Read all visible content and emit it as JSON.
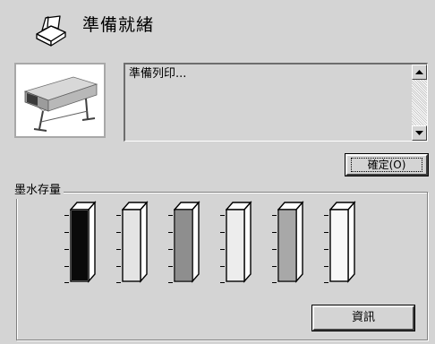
{
  "status": {
    "title": "準備就緒",
    "icon": "printer-status-icon"
  },
  "message": {
    "text": "準備列印..."
  },
  "buttons": {
    "ok_label": "確定(O)",
    "info_label": "資訊"
  },
  "ink": {
    "legend": "墨水存量",
    "cartridges": [
      {
        "color": "#0a0a0a",
        "level": 1.0
      },
      {
        "color": "#e4e4e4",
        "level": 1.0
      },
      {
        "color": "#8e8e8e",
        "level": 1.0
      },
      {
        "color": "#ededed",
        "level": 1.0
      },
      {
        "color": "#a8a8a8",
        "level": 1.0
      },
      {
        "color": "#f8f8f8",
        "level": 1.0
      }
    ]
  },
  "colors": {
    "window_bg": "#d4d4d4",
    "border_dark": "#404040",
    "border_light": "#ffffff"
  }
}
